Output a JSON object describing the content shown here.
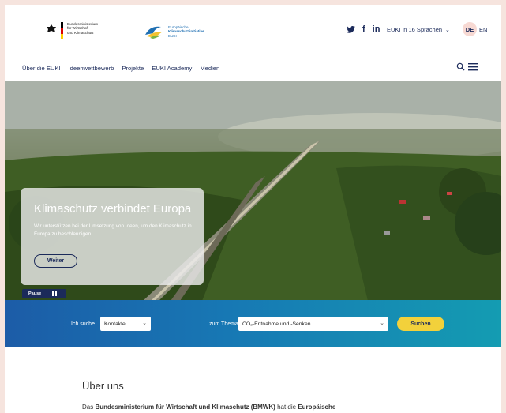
{
  "header": {
    "ministry_lines": [
      "Bundesministerium",
      "für Wirtschaft",
      "und Klimaschutz"
    ],
    "euki_lines": [
      "Europäische",
      "Klimaschutzinitiative",
      "EUKI"
    ],
    "social": [
      "twitter-icon",
      "facebook-icon",
      "linkedin-icon"
    ],
    "social_labels": {
      "facebook": "f",
      "linkedin": "in"
    },
    "languages_label": "EUKI in 16 Sprachen",
    "lang_de": "DE",
    "lang_en": "EN"
  },
  "nav": {
    "items": [
      "Über die EUKI",
      "Ideenwettbewerb",
      "Projekte",
      "EUKI Academy",
      "Medien"
    ]
  },
  "hero": {
    "title": "Klimaschutz verbindet Europa",
    "text": "Wir unterstützen bei der Umsetzung von Ideen, um den Klimaschutz in Europa zu beschleunigen.",
    "button": "Weiter",
    "pause_label": "Pause"
  },
  "search": {
    "label_search": "Ich suche",
    "select_type": "Kontakte",
    "label_topic": "zum Thema",
    "select_topic": "CO₂-Entnahme und -Senken",
    "button": "Suchen"
  },
  "about": {
    "title": "Über uns",
    "text_prefix": "Das ",
    "text_bold1": "Bundesministerium für Wirtschaft und Klimaschutz (BMWK)",
    "text_mid": " hat die ",
    "text_bold2": "Europäische"
  },
  "colors": {
    "navy": "#1b2a5a",
    "accent_yellow": "#f2d13b",
    "band_blue": "#1778b4"
  }
}
